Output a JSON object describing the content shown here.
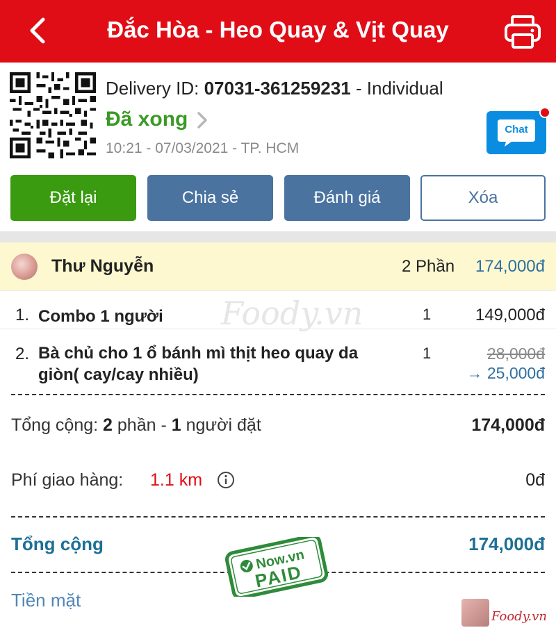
{
  "header": {
    "title": "Đắc Hòa - Heo Quay & Vịt Quay",
    "background": "#e00d16"
  },
  "order": {
    "delivery_label": "Delivery ID: ",
    "delivery_id": "07031-361259231",
    "delivery_type": " - Individual",
    "status": "Đã xong",
    "timestamp": "10:21 - 07/03/2021 - TP. HCM",
    "chat_label": "Chat"
  },
  "actions": {
    "reorder": "Đặt lại",
    "share": "Chia sẻ",
    "rate": "Đánh giá",
    "delete": "Xóa"
  },
  "customer": {
    "name": "Thư Nguyễn",
    "portions": "2 Phần",
    "total": "174,000đ"
  },
  "watermark": "Foody.vn",
  "items": [
    {
      "index": "1.",
      "name": "Combo 1 người",
      "qty": "1",
      "price": "149,000đ"
    },
    {
      "index": "2.",
      "name": "Bà chủ cho 1 ổ bánh mì thịt heo quay da giòn( cay/cay  nhiều)",
      "qty": "1",
      "old_price": "28,000đ",
      "new_price": "→ 25,000đ"
    }
  ],
  "summary": {
    "label_prefix": "Tổng cộng: ",
    "portions_count": "2",
    "portions_text": " phần - ",
    "people_count": "1",
    "people_text": " người đặt",
    "value": "174,000đ"
  },
  "fee": {
    "label": "Phí giao hàng:",
    "distance": "1.1 km",
    "value": "0đ"
  },
  "total": {
    "label": "Tổng cộng",
    "value": "174,000đ"
  },
  "stamp": {
    "top": "Now.vn",
    "bottom": "PAID"
  },
  "payment": {
    "method": "Tiền mặt"
  },
  "foody_brand": "Foody.vn"
}
